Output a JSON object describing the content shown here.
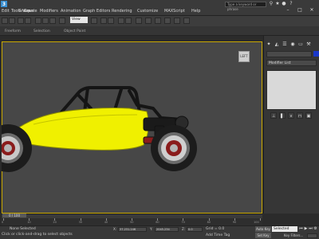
{
  "menu": {
    "items": [
      "Edit",
      "Tools",
      "Group",
      "Views",
      "Create",
      "Modifiers",
      "Animation",
      "Graph Editors",
      "Rendering",
      "Customize",
      "MAXScript",
      "Help"
    ]
  },
  "search": {
    "placeholder": "Type a keyword or phrase"
  },
  "toolbar": {
    "view_dropdown": "View"
  },
  "ribbon": {
    "tabs": [
      "Freeform",
      "Selection",
      "Object Paint"
    ]
  },
  "viewport": {
    "viewcube_label": "LEFT"
  },
  "command_panel": {
    "modifier_list_label": "Modifier List",
    "object_color": "#1a38c8"
  },
  "timeline": {
    "frame_counter": "0 / 100",
    "ticks": [
      "0",
      "10",
      "20",
      "30",
      "40",
      "50",
      "60",
      "70",
      "80",
      "90",
      "100"
    ]
  },
  "status": {
    "selection_text": "None Selected",
    "prompt": "Click or click-and-drag to select objects",
    "x_label": "X:",
    "y_label": "Y:",
    "z_label": "Z:",
    "x_value": "37.231.246",
    "y_value": "2045.234",
    "z_value": "0.0",
    "grid_text": "Grid = 0.0",
    "add_time_tag": "Add Time Tag",
    "auto_key": "Auto Key",
    "set_key": "Set Key",
    "key_mode": "Selected",
    "key_filters": "Key Filters..."
  },
  "colors": {
    "viewport_bg": "#474747",
    "active_viewport_border": "#c9a800",
    "car_body": "#f0f000",
    "frame": "#1a1a1a"
  }
}
